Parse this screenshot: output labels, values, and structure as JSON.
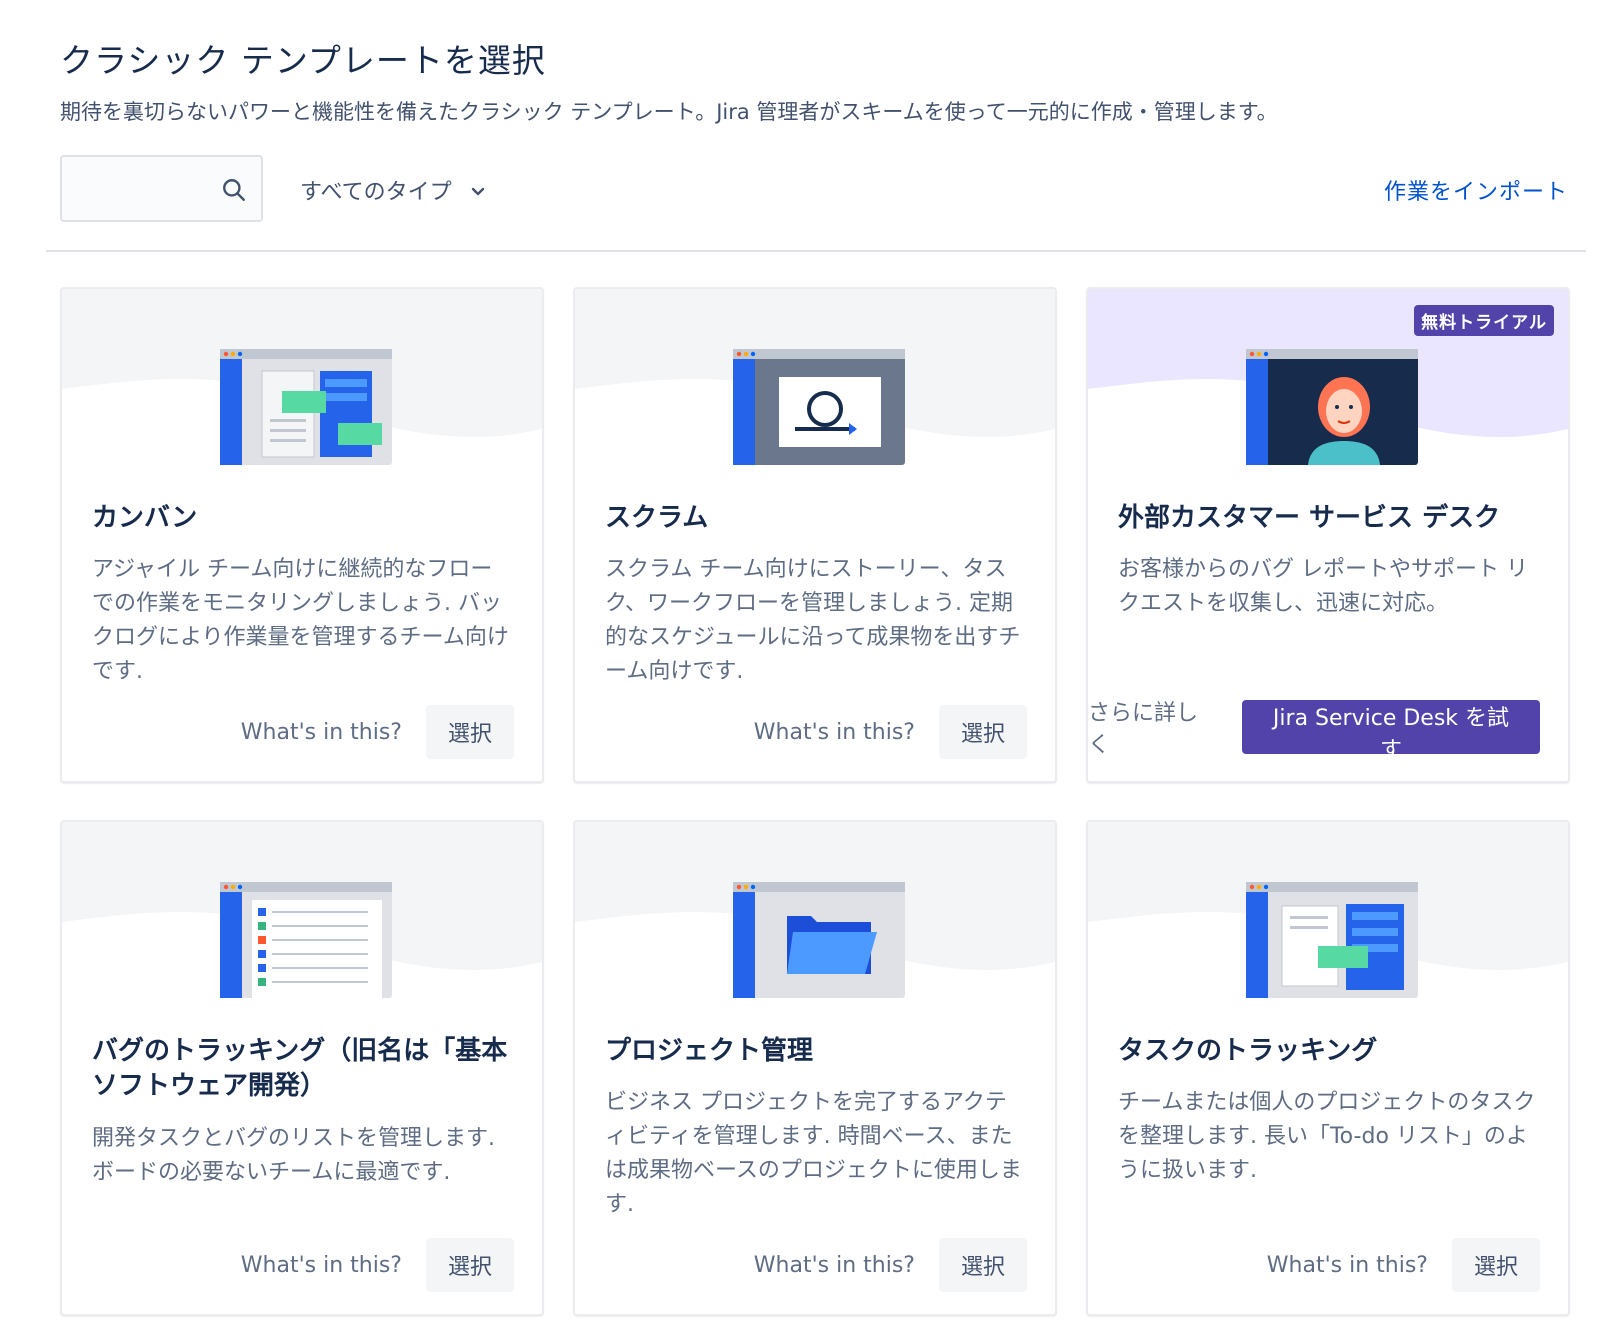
{
  "header": {
    "title": "クラシック テンプレートを選択",
    "subtitle": "期待を裏切らないパワーと機能性を備えたクラシック テンプレート。Jira 管理者がスキームを使って一元的に作成・管理します。"
  },
  "toolbar": {
    "search_value": "",
    "type_filter_label": "すべてのタイプ",
    "import_link": "作業をインポート"
  },
  "cards": [
    {
      "name": "カンバン",
      "description": "アジャイル チーム向けに継続的なフローでの作業をモニタリングしましょう. バックログにより作業量を管理するチーム向けです.",
      "whats_in_this": "What's in this?",
      "select_label": "選択"
    },
    {
      "name": "スクラム",
      "description": "スクラム チーム向けにストーリー、タスク、ワークフローを管理しましょう. 定期的なスケジュールに沿って成果物を出すチーム向けです.",
      "whats_in_this": "What's in this?",
      "select_label": "選択"
    },
    {
      "name": "外部カスタマー サービス デスク",
      "description": "お客様からのバグ レポートやサポート リクエストを収集し、迅速に対応。",
      "badge": "無料トライアル",
      "learn_more": "さらに詳しく",
      "trial_label": "Jira Service Desk を試す"
    },
    {
      "name": "バグのトラッキング（旧名は「基本ソフトウェア開発）",
      "description": "開発タスクとバグのリストを管理します. ボードの必要ないチームに最適です.",
      "whats_in_this": "What's in this?",
      "select_label": "選択"
    },
    {
      "name": "プロジェクト管理",
      "description": "ビジネス プロジェクトを完了するアクティビティを管理します. 時間ベース、または成果物ベースのプロジェクトに使用します.",
      "whats_in_this": "What's in this?",
      "select_label": "選択"
    },
    {
      "name": "タスクのトラッキング",
      "description": "チームまたは個人のプロジェクトのタスクを整理します. 長い「To-do リスト」のように扱います.",
      "whats_in_this": "What's in this?",
      "select_label": "選択"
    }
  ],
  "colors": {
    "primary_link": "#0052cc",
    "trial_purple": "#5243aa",
    "sidebar_blue": "#2563eb",
    "hero_gray": "#f4f5f7",
    "hero_purple": "#eae6ff"
  }
}
